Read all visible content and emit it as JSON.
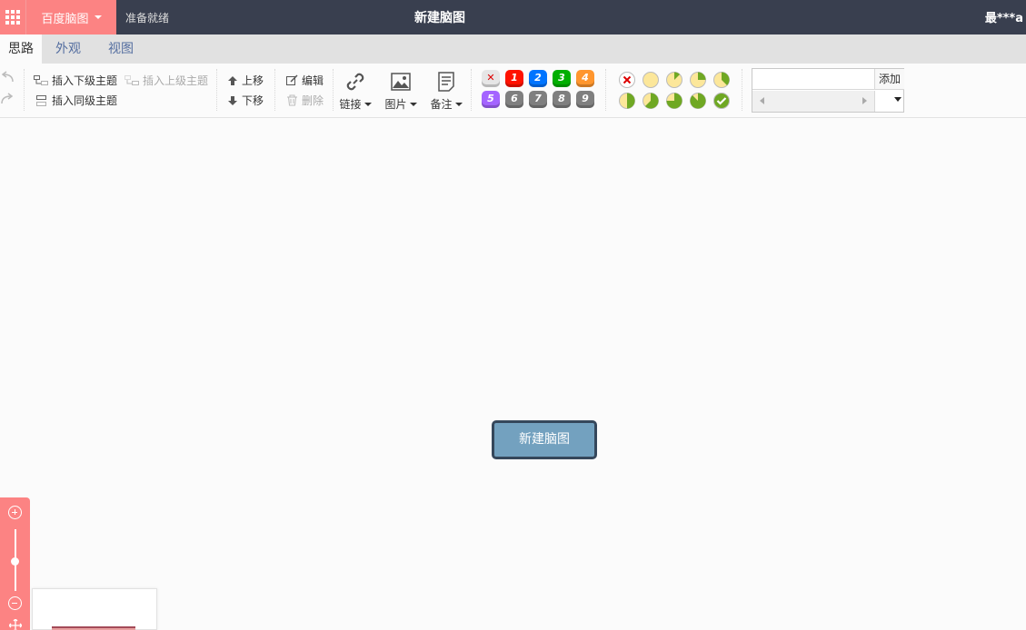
{
  "topbar": {
    "brand": "百度脑图",
    "status": "准备就绪",
    "title": "新建脑图",
    "user": "最***a"
  },
  "tabs": [
    {
      "label": "思路",
      "active": true
    },
    {
      "label": "外观",
      "active": false
    },
    {
      "label": "视图",
      "active": false
    }
  ],
  "toolbar": {
    "insert_child": "插入下级主题",
    "insert_parent": "插入上级主题",
    "insert_sibling": "插入同级主题",
    "move_up": "上移",
    "move_down": "下移",
    "edit": "编辑",
    "delete": "删除",
    "link": "链接",
    "image": "图片",
    "note": "备注",
    "priorities": [
      {
        "label": "✕",
        "color": "#e6e6e6"
      },
      {
        "label": "1",
        "color": "#ff1200"
      },
      {
        "label": "2",
        "color": "#0074ff"
      },
      {
        "label": "3",
        "color": "#00af00"
      },
      {
        "label": "4",
        "color": "#ff962e"
      },
      {
        "label": "5",
        "color": "#a464ff"
      },
      {
        "label": "6",
        "color": "#7f7f7f"
      },
      {
        "label": "7",
        "color": "#7f7f7f"
      },
      {
        "label": "8",
        "color": "#7f7f7f"
      },
      {
        "label": "9",
        "color": "#7f7f7f"
      }
    ],
    "progress": [
      {
        "label": "remove",
        "value": null
      },
      {
        "label": "0",
        "value": 0
      },
      {
        "label": "1/8",
        "value": 0.125
      },
      {
        "label": "1/4",
        "value": 0.25
      },
      {
        "label": "3/8",
        "value": 0.375
      },
      {
        "label": "1/2",
        "value": 0.5
      },
      {
        "label": "5/8",
        "value": 0.625
      },
      {
        "label": "3/4",
        "value": 0.75
      },
      {
        "label": "7/8",
        "value": 0.875
      },
      {
        "label": "done",
        "value": 1
      }
    ],
    "search_placeholder": "",
    "add_label": "添加"
  },
  "canvas": {
    "root_node": "新建脑图"
  },
  "colors": {
    "topbar_bg": "#393f4f",
    "brand_bg": "#fc8383",
    "root_node_bg": "#73a1bf",
    "root_node_border": "#35475b"
  }
}
